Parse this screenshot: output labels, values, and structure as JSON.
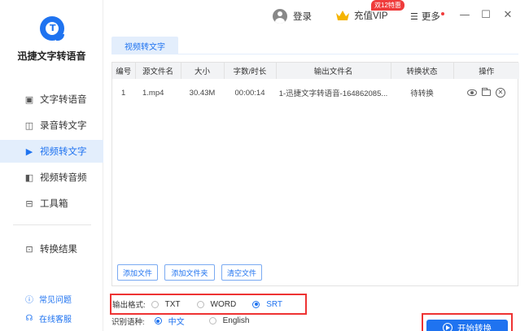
{
  "app": {
    "name": "迅捷文字转语音",
    "logo_letter": "T"
  },
  "sidebar": {
    "items": [
      {
        "label": "文字转语音",
        "icon": "text-to-speech-icon"
      },
      {
        "label": "录音转文字",
        "icon": "recording-to-text-icon"
      },
      {
        "label": "视频转文字",
        "icon": "video-to-text-icon",
        "active": true
      },
      {
        "label": "视频转音频",
        "icon": "video-to-audio-icon"
      },
      {
        "label": "工具箱",
        "icon": "toolbox-icon"
      }
    ],
    "results_label": "转换结果",
    "help": [
      {
        "label": "常见问题",
        "icon": "question-icon"
      },
      {
        "label": "在线客服",
        "icon": "headset-icon"
      }
    ]
  },
  "topbar": {
    "login_label": "登录",
    "vip_label": "充值VIP",
    "vip_badge": "双12特惠",
    "more_label": "更多",
    "window_buttons": [
      "minimize-icon",
      "maximize-icon",
      "close-icon"
    ]
  },
  "tab": {
    "label": "视频转文字"
  },
  "table": {
    "headers": [
      "编号",
      "源文件名",
      "大小",
      "字数/时长",
      "输出文件名",
      "转换状态",
      "操作"
    ],
    "rows": [
      {
        "index": "1",
        "source": "1.mp4",
        "size": "30.43M",
        "duration": "00:00:14",
        "output": "1-迅捷文字转语音-164862085...",
        "status": "待转换"
      }
    ]
  },
  "buttons": {
    "add_file": "添加文件",
    "add_folder": "添加文件夹",
    "clear_files": "清空文件"
  },
  "output_format": {
    "label": "输出格式:",
    "options": [
      "TXT",
      "WORD",
      "SRT"
    ],
    "selected": "SRT"
  },
  "language": {
    "label": "识别语种:",
    "options": [
      "中文",
      "English"
    ],
    "selected": "中文"
  },
  "start_label": "开始转换",
  "colors": {
    "accent": "#1f73f0",
    "highlight_box": "#e33333",
    "active_bg": "#e3eefc"
  }
}
